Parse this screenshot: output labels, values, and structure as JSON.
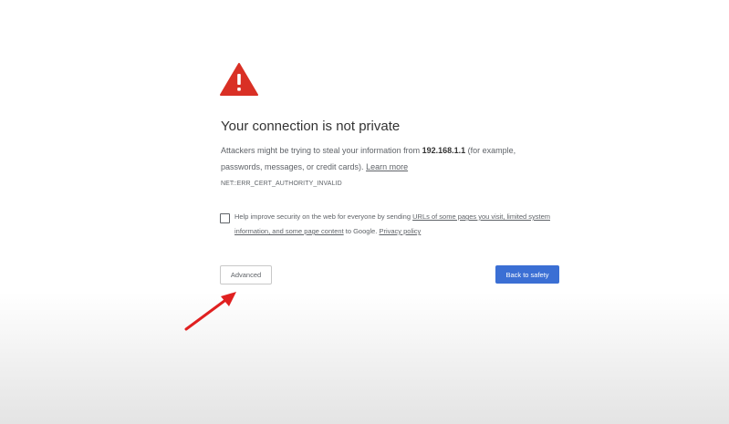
{
  "icons": {
    "warning": "warning-triangle-icon",
    "annotation": "red-arrow-icon"
  },
  "colors": {
    "warning_red": "#d93025",
    "primary_blue": "#3b6fd4",
    "annotation_red": "#e02020"
  },
  "interstitial": {
    "title": "Your connection is not private",
    "body_prefix": "Attackers might be trying to steal your information from ",
    "host": "192.168.1.1",
    "body_suffix": " (for example, passwords, messages, or credit cards). ",
    "learn_more": "Learn more",
    "error_code": "NET::ERR_CERT_AUTHORITY_INVALID"
  },
  "reporting": {
    "checked": false,
    "text_prefix": "Help improve security on the web for everyone by sending ",
    "urls_link": "URLs of some pages you visit, limited system information, and some page content",
    "text_middle": " to Google. ",
    "privacy_link": "Privacy policy"
  },
  "buttons": {
    "advanced": "Advanced",
    "back_to_safety": "Back to safety"
  }
}
